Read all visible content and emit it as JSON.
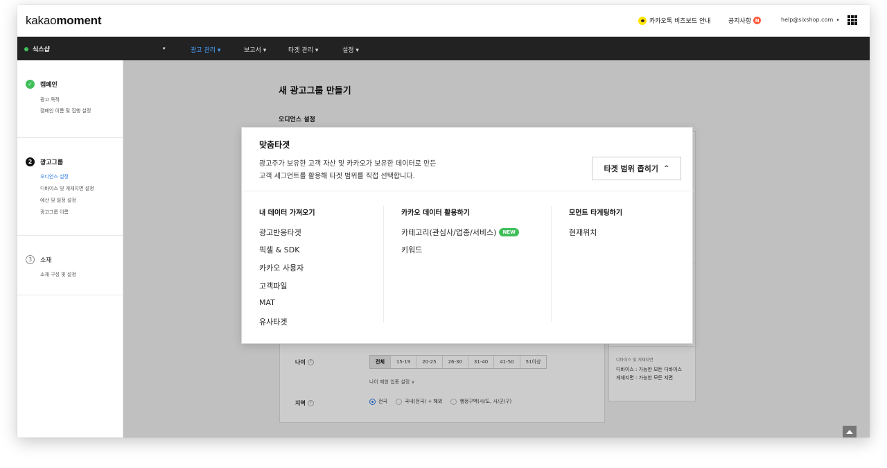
{
  "header": {
    "logo_light": "kakao",
    "logo_bold": "moment",
    "bizboard_guide": "카카오톡 비즈보드 안내",
    "notice": "공지사항",
    "notice_badge": "N",
    "email": "help@sixshop.com",
    "email_caret": "▾"
  },
  "nav": {
    "account": "식스샵",
    "account_caret": "▾",
    "menus": [
      "광고 관리 ▾",
      "보고서 ▾",
      "타겟 관리 ▾",
      "설정 ▾"
    ]
  },
  "sidebar": {
    "steps": [
      {
        "title": "캠페인",
        "subs": [
          "광고 목적",
          "캠페인 이름 및 집행 설정"
        ]
      },
      {
        "number": "2",
        "title": "광고그룹",
        "subs": [
          "오디언스 설정",
          "디바이스 및 게재지면 설정",
          "예산 및 일정 설정",
          "광고그룹 이름"
        ]
      },
      {
        "number": "3",
        "title": "소재",
        "subs": [
          "소재 구성 및 설정"
        ]
      }
    ]
  },
  "main": {
    "title": "새 광고그룹 만들기",
    "subtitle": "오디언스 설정",
    "age_label": "나이",
    "age_options": [
      "전체",
      "15-19",
      "20-25",
      "26-30",
      "31-40",
      "41-50",
      "51이상"
    ],
    "age_selected": "전체",
    "age_limit": "나이 제한 업종 설정 ∨",
    "region_label": "지역",
    "region_options": [
      "전국",
      "국내(전국) + 해외",
      "행정구역(시/도, 시/군/구)"
    ],
    "region_selected": "전국",
    "help_mark": "?"
  },
  "side_summary": {
    "heading": "디바이스 및 게재지면",
    "device": "디바이스 : 가능한 모든 디바이스",
    "placement": "게재지면 : 가능한 모든 지면"
  },
  "popup": {
    "title": "맞춤타겟",
    "desc_line1": "광고주가 보유한 고객 자산 및 카카오가 보유한 데이터로 만든",
    "desc_line2": "고객 세그먼트를 활용해 타겟 범위를 직접 선택합니다.",
    "narrow_button": "타겟 범위 좁히기",
    "narrow_chevron": "^",
    "columns": [
      {
        "heading": "내 데이터 가져오기",
        "items": [
          "광고반응타겟",
          "픽셀 & SDK",
          "카카오 사용자",
          "고객파일",
          "MAT",
          "유사타겟"
        ]
      },
      {
        "heading": "카카오 데이터 활용하기",
        "items": [
          "카테고리(관심사/업종/서비스)",
          "키워드"
        ]
      },
      {
        "heading": "모먼트 타게팅하기",
        "items": [
          "현재위치"
        ]
      }
    ],
    "new_badge": "NEW"
  },
  "colors": {
    "accent_blue": "#49a3ff",
    "green": "#3fbf5a",
    "nav_bg": "#222222",
    "kakao_yellow": "#fee500"
  }
}
